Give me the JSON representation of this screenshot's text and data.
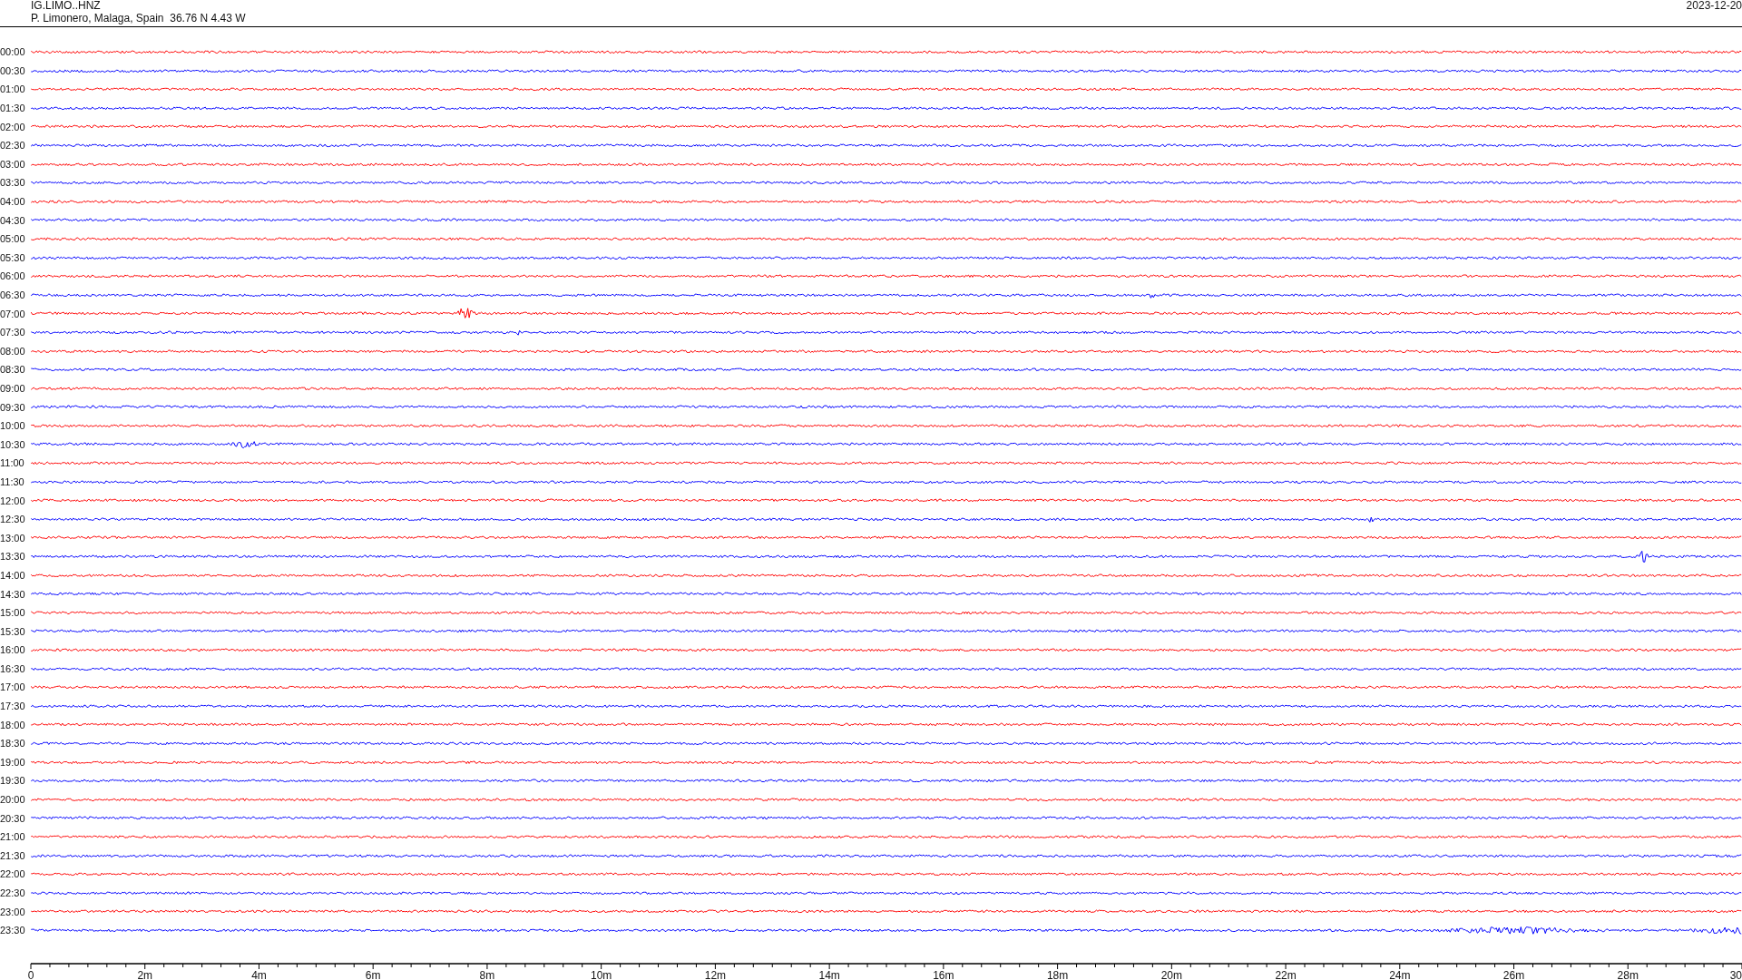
{
  "header": {
    "station": "IG.LIMO..HNZ",
    "location": "P. Limonero, Malaga, Spain  36.76 N 4.43 W",
    "date": "2023-12-20"
  },
  "traces": [
    {
      "label": "00:00",
      "color": "#ff0000"
    },
    {
      "label": "00:30",
      "color": "#0000ff"
    },
    {
      "label": "01:00",
      "color": "#ff0000"
    },
    {
      "label": "01:30",
      "color": "#0000ff"
    },
    {
      "label": "02:00",
      "color": "#ff0000"
    },
    {
      "label": "02:30",
      "color": "#0000ff"
    },
    {
      "label": "03:00",
      "color": "#ff0000"
    },
    {
      "label": "03:30",
      "color": "#0000ff"
    },
    {
      "label": "04:00",
      "color": "#ff0000"
    },
    {
      "label": "04:30",
      "color": "#0000ff"
    },
    {
      "label": "05:00",
      "color": "#ff0000"
    },
    {
      "label": "05:30",
      "color": "#0000ff"
    },
    {
      "label": "06:00",
      "color": "#ff0000"
    },
    {
      "label": "06:30",
      "color": "#0000ff"
    },
    {
      "label": "07:00",
      "color": "#ff0000"
    },
    {
      "label": "07:30",
      "color": "#0000ff"
    },
    {
      "label": "08:00",
      "color": "#ff0000"
    },
    {
      "label": "08:30",
      "color": "#0000ff"
    },
    {
      "label": "09:00",
      "color": "#ff0000"
    },
    {
      "label": "09:30",
      "color": "#0000ff"
    },
    {
      "label": "10:00",
      "color": "#ff0000"
    },
    {
      "label": "10:30",
      "color": "#0000ff"
    },
    {
      "label": "11:00",
      "color": "#ff0000"
    },
    {
      "label": "11:30",
      "color": "#0000ff"
    },
    {
      "label": "12:00",
      "color": "#ff0000"
    },
    {
      "label": "12:30",
      "color": "#0000ff"
    },
    {
      "label": "13:00",
      "color": "#ff0000"
    },
    {
      "label": "13:30",
      "color": "#0000ff"
    },
    {
      "label": "14:00",
      "color": "#ff0000"
    },
    {
      "label": "14:30",
      "color": "#0000ff"
    },
    {
      "label": "15:00",
      "color": "#ff0000"
    },
    {
      "label": "15:30",
      "color": "#0000ff"
    },
    {
      "label": "16:00",
      "color": "#ff0000"
    },
    {
      "label": "16:30",
      "color": "#0000ff"
    },
    {
      "label": "17:00",
      "color": "#ff0000"
    },
    {
      "label": "17:30",
      "color": "#0000ff"
    },
    {
      "label": "18:00",
      "color": "#ff0000"
    },
    {
      "label": "18:30",
      "color": "#0000ff"
    },
    {
      "label": "19:00",
      "color": "#ff0000"
    },
    {
      "label": "19:30",
      "color": "#0000ff"
    },
    {
      "label": "20:00",
      "color": "#ff0000"
    },
    {
      "label": "20:30",
      "color": "#0000ff"
    },
    {
      "label": "21:00",
      "color": "#ff0000"
    },
    {
      "label": "21:30",
      "color": "#0000ff"
    },
    {
      "label": "22:00",
      "color": "#ff0000"
    },
    {
      "label": "22:30",
      "color": "#0000ff"
    },
    {
      "label": "23:00",
      "color": "#ff0000"
    },
    {
      "label": "23:30",
      "color": "#0000ff"
    }
  ],
  "x_axis": {
    "ticks": [
      "0",
      "2m",
      "4m",
      "6m",
      "8m",
      "10m",
      "12m",
      "14m",
      "16m",
      "18m",
      "20m",
      "22m",
      "24m",
      "26m",
      "28m",
      "30"
    ]
  }
}
